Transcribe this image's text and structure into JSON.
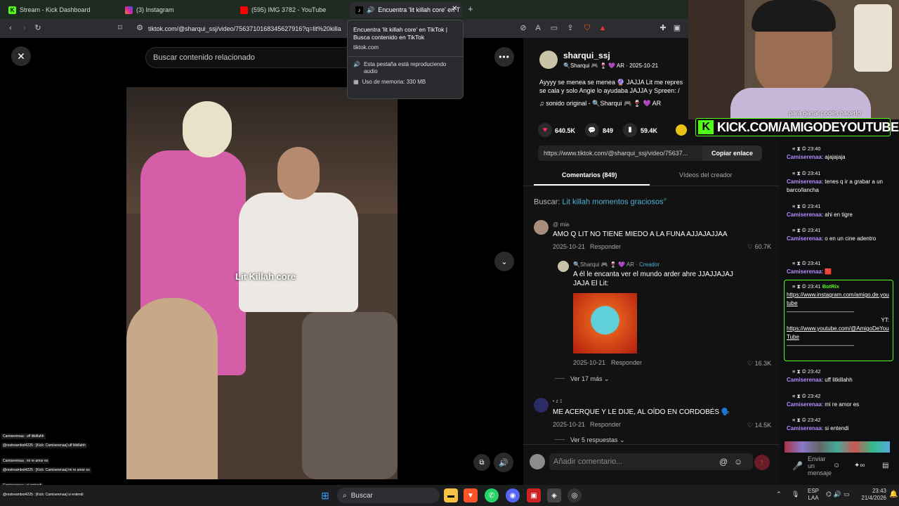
{
  "browser": {
    "tabs": [
      {
        "title": "Stream - Kick Dashboard",
        "color": "#53fc18"
      },
      {
        "title": "(3) Instagram",
        "color": "#d6249f"
      },
      {
        "title": "(595) IMG 3782 - YouTube",
        "color": "#ff0000"
      },
      {
        "title": "Encuentra 'lit killah core' en T",
        "color": "#ffffff"
      }
    ],
    "new_tab": "+",
    "url": "tiktok.com/@sharqui_ssj/video/7563710168345627916?q=lit%20killa"
  },
  "tooltip": {
    "title": "Encuentra 'lit killah core' en TikTok | Busca contenido en TikTok",
    "domain": "tiktok.com",
    "audio": "Esta pestaña está reproduciendo audio",
    "memory": "Uso de memoria: 330 MB"
  },
  "video": {
    "search_placeholder": "Buscar contenido relacionado",
    "caption": "Lit Killah core"
  },
  "post": {
    "username": "sharqui_ssj",
    "display": "🔍Sharqui 🎮 🍷 💜 AR",
    "date": "2025-10-21",
    "description_1": "Ayyyy se menea se menea 🔮 JAJJA Lit me repres",
    "description_2": "se cala y solo Angie lo ayudaba JAJJA y Spreen: /",
    "sound": "sonido original - 🔍Sharqui 🎮 🍷 💜 AR",
    "likes": "640.5K",
    "comments": "849",
    "saves": "59.4K",
    "link": "https://www.tiktok.com/@sharqui_ssj/video/75637...",
    "copy_label": "Copiar enlace",
    "tab_comments": "Comentarios (849)",
    "tab_videos": "Vídeos del creador",
    "search_label": "Buscar:",
    "search_term": "Lit killah momentos graciosos"
  },
  "comments": [
    {
      "user": "@ mia",
      "text": "AMO Q LIT NO TIENE MIEDO A LA FUNA AJJAJAJJAA",
      "date": "2025-10-21",
      "reply": "Responder",
      "likes": "60.7K"
    },
    {
      "user": "🔍Sharqui 🎮 🍷 💜 AR",
      "badge": "Creador",
      "text_1": "A él le encanta ver el mundo arder ahre JJAJJAJAJ",
      "text_2": "JAJA El Lit:",
      "date": "2025-10-21",
      "reply": "Responder",
      "likes": "16.3K"
    },
    {
      "user": "• z 1",
      "text": "ME ACERQUE Y LE DIJE, AL OÍDO EN CORDOBÉS 🗣️",
      "date": "2025-10-21",
      "reply": "Responder",
      "likes": "14.5K"
    }
  ],
  "more_replies_1": "Ver 17 más",
  "more_replies_2": "Ver 5 respuestas",
  "add_comment": "Añadir comentario...",
  "overlay": {
    "goal_text": "para ganar podes hacerlo",
    "kick_banner": "KICK.COM/AMIGODEYOUTUBE"
  },
  "chat": [
    {
      "time": "23:40",
      "user": "Camiserenaa",
      "text": "ajajajaja"
    },
    {
      "time": "23:41",
      "user": "Camiserenaa",
      "text": "tenes q ir a grabar a un barco/lancha"
    },
    {
      "time": "23:41",
      "user": "Camiserenaa",
      "text": "ahi en tigre"
    },
    {
      "time": "23:41",
      "user": "Camiserenaa",
      "text": "o en un cine adentro"
    },
    {
      "time": "23:41",
      "user": "Camiserenaa",
      "text": "🟥"
    },
    {
      "time": "23:41",
      "user": "BotRix",
      "text": "https://www.instagram.com/amigo.de.youtube"
    },
    {
      "time": "23:42",
      "user": "Camiserenaa",
      "text": "uff litkillahh"
    },
    {
      "time": "23:42",
      "user": "Camiserenaa",
      "text": "mi re amor es"
    },
    {
      "time": "23:42",
      "user": "Camiserenaa",
      "text": "si entendi"
    }
  ],
  "botrix_extra": {
    "yt_label": "YT:",
    "yt_link": "https://www.youtube.com/@AmigoDeYouTube",
    "dashes": "————————————"
  },
  "chat_input": {
    "placeholder": "Enviar un mensaje"
  },
  "mini_chat": [
    "Camiserenaa : uff litkillahh",
    "@restreambot4225 : [Kick: Camiserenaa] uff litkillahh",
    "Camiserenaa : mi re amor es",
    "@restreambot4225 : [Kick: Camiserenaa] mi re amor es",
    "Camiserenaa : si entendi",
    "@restreambot4225 : [Kick: Camiserenaa] si entendi"
  ],
  "taskbar": {
    "search": "Buscar",
    "lang_1": "ESP",
    "lang_2": "LAA",
    "time": "23:43",
    "date": "21/4/2026"
  }
}
